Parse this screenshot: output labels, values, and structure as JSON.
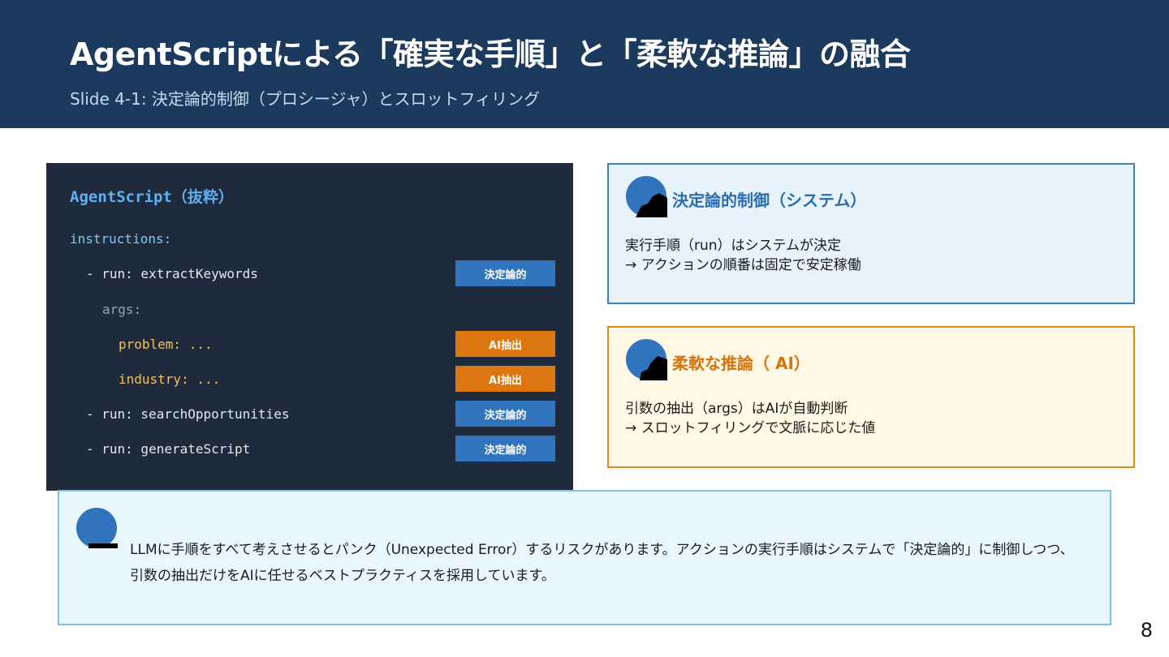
{
  "header": {
    "title": "AgentScriptによる「確実な手順」と「柔軟な推論」の融合",
    "subtitle": "Slide 4-1: 決定論的制御（プロシージャ）とスロットフィリング"
  },
  "code": {
    "title": "AgentScript（抜粋）",
    "lines": [
      "instructions:",
      "- run: extractKeywords",
      "args:",
      "problem: ...",
      "industry: ...",
      "- run: searchOpportunities",
      "- run: generateScript"
    ],
    "badges": {
      "extract": "決定論的",
      "problem": "AI抽出",
      "industry": "AI抽出",
      "search": "決定論的",
      "generate": "決定論的"
    }
  },
  "cards": {
    "deterministic": {
      "title": "決定論的制御（システム）",
      "line1": "実行手順（run）はシステムが決定",
      "line2": "→ アクションの順番は固定で安定稼働"
    },
    "flexible": {
      "title": "柔軟な推論（ AI）",
      "line1": "引数の抽出（args）はAIが自動判断",
      "line2": "→ スロットフィリングで文脈に応じた値"
    }
  },
  "note": {
    "line1": "LLMに手順をすべて考えさせるとパンク（Unexpected Error）するリスクがあります。アクションの実行手順はシステムで「決定論的」に制御しつつ、",
    "line2": "引数の抽出だけをAIに任せるベストプラクティスを採用しています。"
  },
  "page_number": "8",
  "colors": {
    "header_bg": "#1b3a5e",
    "code_bg": "#1f2a3d",
    "deterministic": "#2f74bd",
    "ai": "#dc7610"
  },
  "icons": {
    "deterministic_card": "computer-icon",
    "flexible_card": "brain-icon",
    "note": "info-icon"
  }
}
